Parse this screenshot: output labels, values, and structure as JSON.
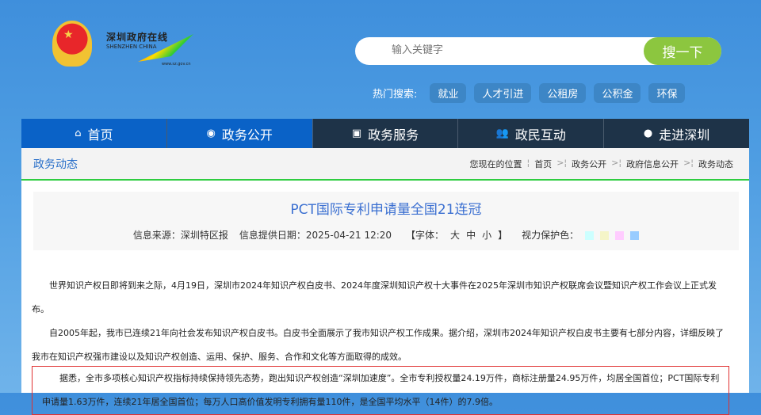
{
  "header": {
    "logo_cn": "深圳政府在线",
    "logo_en": "SHENZHEN CHINA",
    "logo_url": "www.sz.gov.cn",
    "search_placeholder": "输入关键字",
    "search_button": "搜一下",
    "hot_label": "热门搜索:",
    "hot_tags": [
      "就业",
      "人才引进",
      "公租房",
      "公积金",
      "环保"
    ]
  },
  "nav": [
    {
      "label": "首页",
      "icon": "home-icon"
    },
    {
      "label": "政务公开",
      "icon": "news-icon"
    },
    {
      "label": "政务服务",
      "icon": "monitor-icon"
    },
    {
      "label": "政民互动",
      "icon": "people-icon"
    },
    {
      "label": "走进深圳",
      "icon": "info-icon"
    }
  ],
  "section": "政务动态",
  "breadcrumb": {
    "prefix": "您现在的位置",
    "items": [
      "首页",
      "政务公开",
      "政府信息公开",
      "政务动态"
    ]
  },
  "article": {
    "title": "PCT国际专利申请量全国21连冠",
    "source": "信息来源：深圳特区报",
    "date": "信息提供日期：2025-04-21 12:20",
    "font_open": "【字体：",
    "font_sizes": [
      "大",
      "中",
      "小"
    ],
    "font_close": "】",
    "eye_label": "视力保护色：",
    "eye_colors": [
      "#ccffff",
      "#f5f5c8",
      "#ffccff",
      "#99ccff"
    ],
    "paragraphs": [
      "世界知识产权日即将到来之际，4月19日，深圳市2024年知识产权白皮书、2024年度深圳知识产权十大事件在2025年深圳市知识产权联席会议暨知识产权工作会议上正式发布。",
      "自2005年起，我市已连续21年向社会发布知识产权白皮书。白皮书全面展示了我市知识产权工作成果。据介绍，深圳市2024年知识产权白皮书主要有七部分内容，详细反映了我市在知识产权强市建设以及知识产权创造、运用、保护、服务、合作和文化等方面取得的成效。",
      "据悉，全市多项核心知识产权指标持续保持领先态势，跑出知识产权创造“深圳加速度”。全市专利授权量24.19万件，商标注册量24.95万件，均居全国首位；PCT国际专利申请量1.63万件，连续21年居全国首位；每万人口高价值发明专利拥有量110件，是全国平均水平（14件）的7.9倍。"
    ]
  }
}
